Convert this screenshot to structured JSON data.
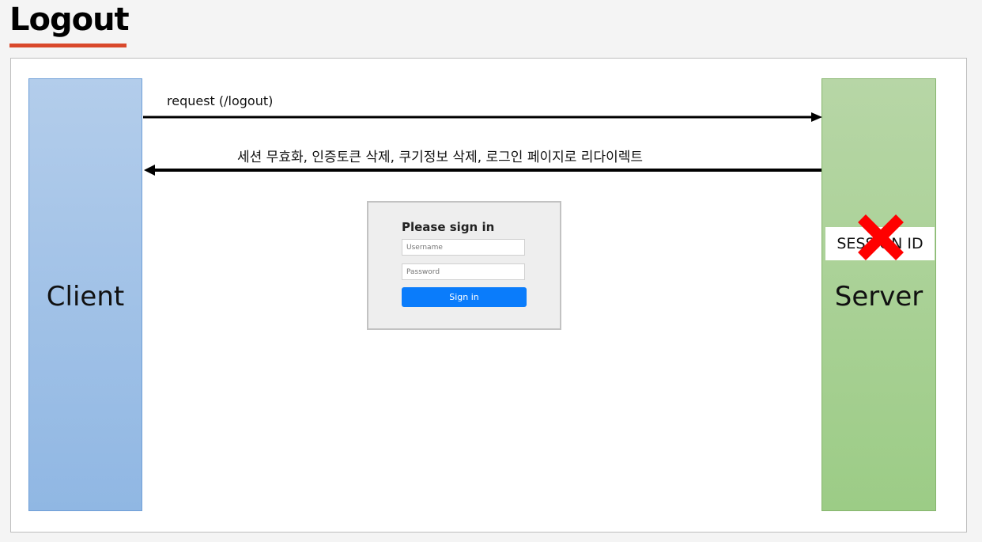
{
  "title": "Logout",
  "client": {
    "label": "Client"
  },
  "server": {
    "label": "Server"
  },
  "arrows": {
    "request": "request (/logout)",
    "response": "세션 무효화,  인증토큰 삭제, 쿠기정보 삭제, 로그인 페이지로 리다이렉트"
  },
  "login_form": {
    "title": "Please sign in",
    "username_placeholder": "Username",
    "password_placeholder": "Password",
    "button_label": "Sign in",
    "button_color": "#0a7cfb"
  },
  "session": {
    "label": "SESSION ID",
    "status_icon": "cross-icon",
    "status_color": "#ff0000"
  },
  "colors": {
    "accent": "#d9482b",
    "client": "#9dbfe6",
    "server": "#a8d093"
  }
}
